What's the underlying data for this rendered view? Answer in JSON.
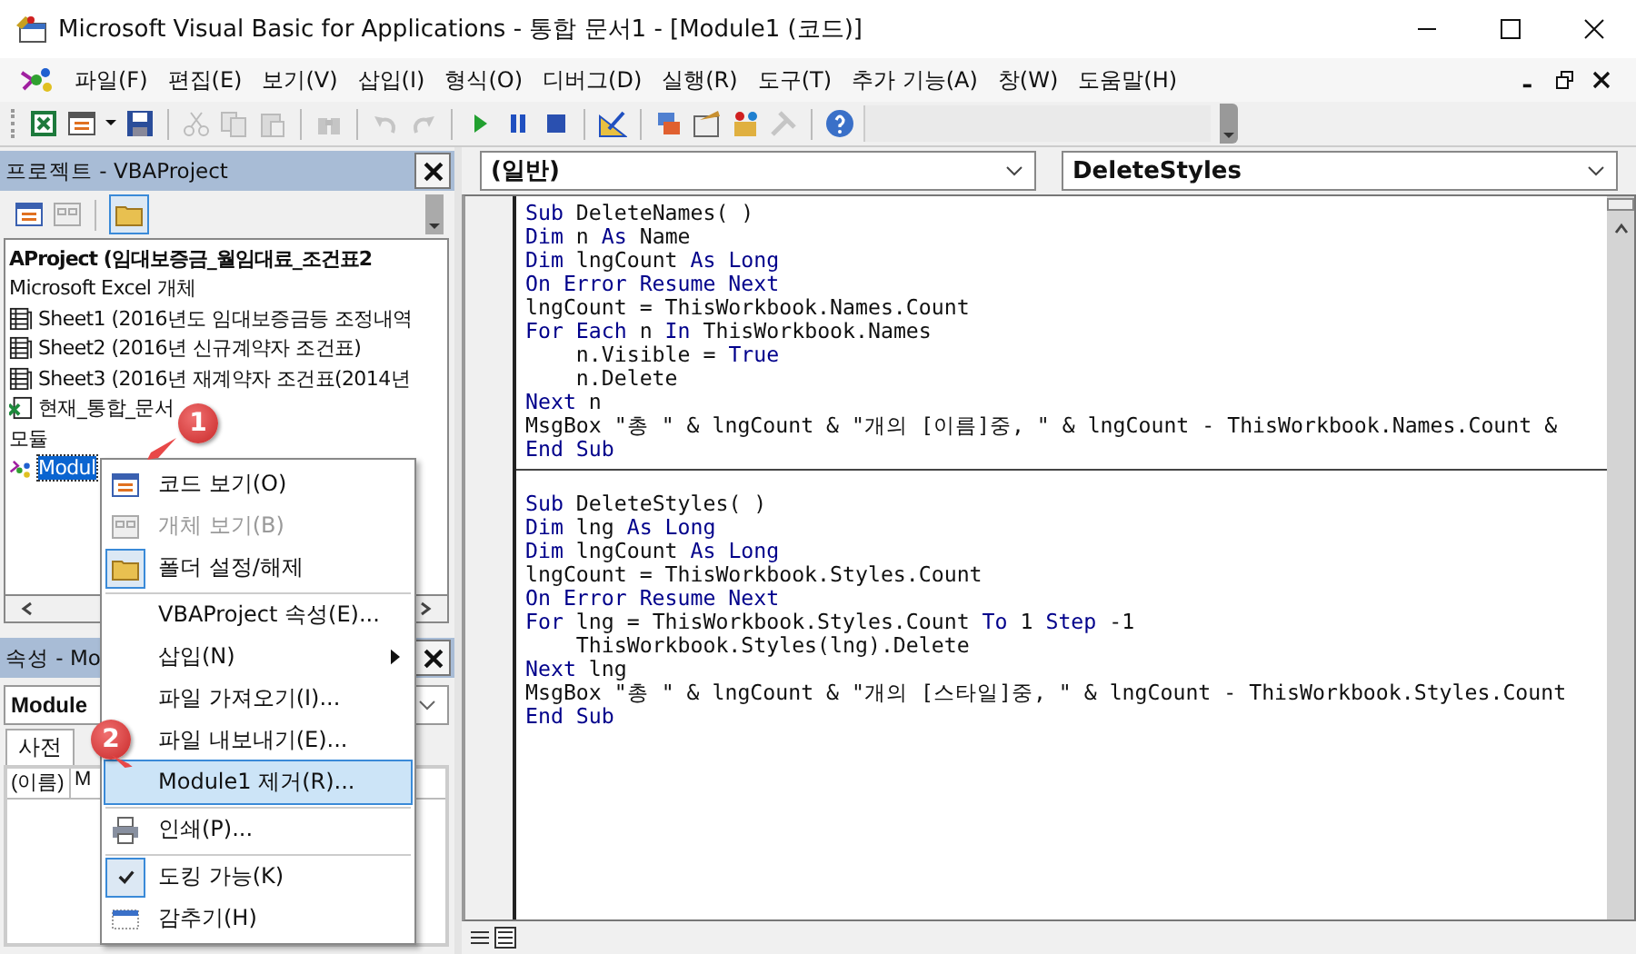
{
  "window": {
    "title": "Microsoft Visual Basic for Applications - 통합 문서1 - [Module1 (코드)]"
  },
  "menu_bar": [
    "파일(F)",
    "편집(E)",
    "보기(V)",
    "삽입(I)",
    "형식(O)",
    "디버그(D)",
    "실행(R)",
    "도구(T)",
    "추가 기능(A)",
    "창(W)",
    "도움말(H)"
  ],
  "project_explorer": {
    "title": "프로젝트 - VBAProject",
    "tree": [
      {
        "label": "AProject (임대보증금_월임대료_조건표2",
        "kind": "project",
        "selected": false,
        "children": [
          {
            "label": "Microsoft Excel 개체",
            "selected": false,
            "children": [
              {
                "label": "Sheet1 (2016년도 임대보증금등 조정내역",
                "kind": "sheet",
                "selected": false
              },
              {
                "label": "Sheet2 (2016년 신규계약자 조건표)",
                "kind": "sheet",
                "selected": false
              },
              {
                "label": "Sheet3 (2016년 재계약자 조건표(2014년 ",
                "kind": "sheet",
                "selected": false
              },
              {
                "label": "현재_통합_문서",
                "kind": "workbook",
                "selected": false
              }
            ]
          },
          {
            "label": "모듈",
            "selected": false,
            "children": [
              {
                "label": "Modul",
                "kind": "module",
                "selected": true
              }
            ]
          }
        ]
      }
    ]
  },
  "properties": {
    "title": "속성 - Mo",
    "object": "Module",
    "tab": "사전",
    "column_1": "(이름)",
    "column_2": "M"
  },
  "context_menu": [
    {
      "label": "코드 보기(O)",
      "disabled": false,
      "checked": false,
      "selected": false,
      "separator_before": false,
      "submenu": false
    },
    {
      "label": "개체 보기(B)",
      "disabled": true,
      "checked": false,
      "selected": false,
      "separator_before": false,
      "submenu": false
    },
    {
      "label": "폴더 설정/해제",
      "disabled": false,
      "checked": true,
      "selected": false,
      "separator_before": false,
      "submenu": false
    },
    {
      "label": "VBAProject 속성(E)...",
      "disabled": false,
      "checked": false,
      "selected": false,
      "separator_before": true,
      "submenu": false
    },
    {
      "label": "삽입(N)",
      "disabled": false,
      "checked": false,
      "selected": false,
      "separator_before": false,
      "submenu": true
    },
    {
      "label": "파일 가져오기(I)...",
      "disabled": false,
      "checked": false,
      "selected": false,
      "separator_before": false,
      "submenu": false
    },
    {
      "label": "파일 내보내기(E)...",
      "disabled": false,
      "checked": false,
      "selected": false,
      "separator_before": false,
      "submenu": false
    },
    {
      "label": "Module1 제거(R)...",
      "disabled": false,
      "checked": false,
      "selected": true,
      "separator_before": false,
      "submenu": false
    },
    {
      "label": "인쇄(P)...",
      "disabled": false,
      "checked": false,
      "selected": false,
      "separator_before": true,
      "submenu": false
    },
    {
      "label": "도킹 가능(K)",
      "disabled": false,
      "checked": true,
      "selected": false,
      "separator_before": true,
      "submenu": false
    },
    {
      "label": "감추기(H)",
      "disabled": false,
      "checked": false,
      "selected": false,
      "separator_before": false,
      "submenu": false
    }
  ],
  "callouts": [
    "1",
    "2"
  ],
  "code_window": {
    "object": "(일반)",
    "procedure": "DeleteStyles",
    "procedures": [
      {
        "lines": [
          [
            {
              "kind": "keyword",
              "text": "Sub"
            },
            {
              "kind": "plain",
              "text": " DeleteNames( )"
            }
          ],
          [
            {
              "kind": "keyword",
              "text": "Dim"
            },
            {
              "kind": "plain",
              "text": " n "
            },
            {
              "kind": "keyword",
              "text": "As"
            },
            {
              "kind": "plain",
              "text": " Name"
            }
          ],
          [
            {
              "kind": "keyword",
              "text": "Dim"
            },
            {
              "kind": "plain",
              "text": " lngCount "
            },
            {
              "kind": "keyword",
              "text": "As Long"
            }
          ],
          [
            {
              "kind": "keyword",
              "text": "On Error Resume Next"
            }
          ],
          [
            {
              "kind": "plain",
              "text": "lngCount = ThisWorkbook.Names.Count"
            }
          ],
          [
            {
              "kind": "keyword",
              "text": "For Each"
            },
            {
              "kind": "plain",
              "text": " n "
            },
            {
              "kind": "keyword",
              "text": "In"
            },
            {
              "kind": "plain",
              "text": " ThisWorkbook.Names"
            }
          ],
          [
            {
              "kind": "plain",
              "text": "    n.Visible = "
            },
            {
              "kind": "keyword",
              "text": "True"
            }
          ],
          [
            {
              "kind": "plain",
              "text": "    n.Delete"
            }
          ],
          [
            {
              "kind": "keyword",
              "text": "Next"
            },
            {
              "kind": "plain",
              "text": " n"
            }
          ],
          [
            {
              "kind": "plain",
              "text": "MsgBox \"총 \" & lngCount & \"개의 [이름]중, \" & lngCount - ThisWorkbook.Names.Count &"
            }
          ],
          [
            {
              "kind": "keyword",
              "text": "End Sub"
            }
          ]
        ]
      },
      {
        "lines": [
          [
            {
              "kind": "keyword",
              "text": "Sub"
            },
            {
              "kind": "plain",
              "text": " DeleteStyles( )"
            }
          ],
          [
            {
              "kind": "keyword",
              "text": "Dim"
            },
            {
              "kind": "plain",
              "text": " lng "
            },
            {
              "kind": "keyword",
              "text": "As Long"
            }
          ],
          [
            {
              "kind": "keyword",
              "text": "Dim"
            },
            {
              "kind": "plain",
              "text": " lngCount "
            },
            {
              "kind": "keyword",
              "text": "As Long"
            }
          ],
          [
            {
              "kind": "plain",
              "text": "lngCount = ThisWorkbook.Styles.Count"
            }
          ],
          [
            {
              "kind": "keyword",
              "text": "On Error Resume Next"
            }
          ],
          [
            {
              "kind": "keyword",
              "text": "For"
            },
            {
              "kind": "plain",
              "text": " lng = ThisWorkbook.Styles.Count "
            },
            {
              "kind": "keyword",
              "text": "To"
            },
            {
              "kind": "plain",
              "text": " 1 "
            },
            {
              "kind": "keyword",
              "text": "Step"
            },
            {
              "kind": "plain",
              "text": " -1"
            }
          ],
          [
            {
              "kind": "plain",
              "text": "    ThisWorkbook.Styles(lng).Delete"
            }
          ],
          [
            {
              "kind": "keyword",
              "text": "Next"
            },
            {
              "kind": "plain",
              "text": " lng"
            }
          ],
          [
            {
              "kind": "plain",
              "text": "MsgBox \"총 \" & lngCount & \"개의 [스타일]중, \" & lngCount - ThisWorkbook.Styles.Count"
            }
          ],
          [
            {
              "kind": "keyword",
              "text": "End Sub"
            }
          ]
        ]
      }
    ]
  }
}
